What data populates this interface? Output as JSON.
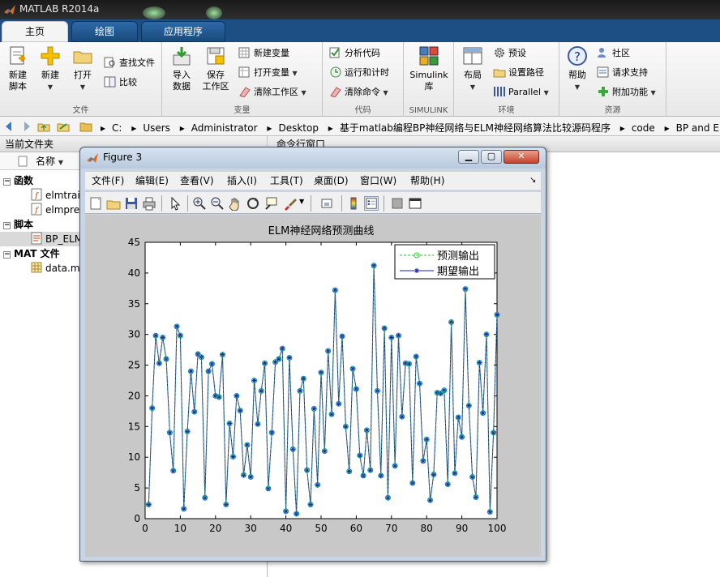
{
  "app": {
    "title": "MATLAB R2014a"
  },
  "tabs": [
    {
      "label": "主页",
      "active": true
    },
    {
      "label": "绘图",
      "active": false
    },
    {
      "label": "应用程序",
      "active": false
    }
  ],
  "ribbon": {
    "file": {
      "label": "文件",
      "new_script": "新建\n脚本",
      "new": "新建",
      "open": "打开",
      "find_files": "查找文件",
      "compare": "比较"
    },
    "variable": {
      "label": "变量",
      "import": "导入\n数据",
      "save_ws": "保存\n工作区",
      "new_var": "新建变量",
      "open_var": "打开变量",
      "clear_ws": "清除工作区"
    },
    "code": {
      "label": "代码",
      "analyze": "分析代码",
      "run_time": "运行和计时",
      "clear_cmd": "清除命令"
    },
    "simulink": {
      "label": "SIMULINK",
      "simulink_lib": "Simulink\n库"
    },
    "environment": {
      "label": "环境",
      "layout": "布局",
      "preferences": "预设",
      "set_path": "设置路径",
      "parallel": "Parallel"
    },
    "resources": {
      "label": "资源",
      "help": "帮助",
      "community": "社区",
      "request_support": "请求支持",
      "addons": "附加功能"
    }
  },
  "address": {
    "crumbs": [
      "C:",
      "Users",
      "Administrator",
      "Desktop",
      "基于matlab编程BP神经网络与ELM神经网络算法比较源码程序",
      "code",
      "BP and ELM"
    ]
  },
  "left_panel": {
    "title": "当前文件夹",
    "column_name": "名称",
    "groups": [
      {
        "label": "函数",
        "items": [
          "elmtrain",
          "elmpredict"
        ]
      },
      {
        "label": "脚本",
        "items": [
          "BP_ELM"
        ]
      },
      {
        "label": "MAT 文件",
        "items": [
          "data.mat"
        ]
      }
    ],
    "visible_items": {
      "elmtrain": "elmtrai",
      "elmpredict": "elmpre",
      "bp_elm": "BP_ELM",
      "data": "data.m"
    }
  },
  "right_panel": {
    "title": "命令行窗口"
  },
  "figure": {
    "title": "Figure 3",
    "menu": [
      "文件(F)",
      "编辑(E)",
      "查看(V)",
      "插入(I)",
      "工具(T)",
      "桌面(D)",
      "窗口(W)",
      "帮助(H)"
    ],
    "toolbar_icons": [
      "new-figure-icon",
      "open-icon",
      "save-icon",
      "print-icon",
      "pointer-icon",
      "zoom-in-icon",
      "zoom-out-icon",
      "pan-icon",
      "rotate-icon",
      "data-cursor-icon",
      "brush-icon",
      "link-icon",
      "colorbar-icon",
      "legend-icon",
      "hide-tools-icon",
      "show-tools-icon"
    ]
  },
  "colors": {
    "expected": "#1c1ca8",
    "predicted": "#2ec82e",
    "marker": "#009999"
  },
  "chart_data": {
    "type": "line",
    "title": "ELM神经网络预测曲线",
    "xlabel": "",
    "ylabel": "",
    "xlim": [
      0,
      100
    ],
    "ylim": [
      0,
      45
    ],
    "xticks": [
      0,
      10,
      20,
      30,
      40,
      50,
      60,
      70,
      80,
      90,
      100
    ],
    "yticks": [
      0,
      5,
      10,
      15,
      20,
      25,
      30,
      35,
      40,
      45
    ],
    "legend_position": "top-right",
    "series": [
      {
        "name": "预测输出",
        "style": "dashed-circle",
        "values": [
          2.3,
          18.0,
          29.8,
          25.3,
          29.5,
          26.0,
          14.0,
          7.8,
          31.3,
          29.8,
          1.6,
          14.2,
          24.0,
          17.4,
          26.8,
          26.3,
          3.4,
          24.0,
          25.2,
          20.0,
          19.8,
          26.7,
          2.3,
          15.5,
          10.1,
          20.0,
          17.6,
          7.1,
          12.0,
          6.8,
          22.5,
          15.4,
          20.8,
          25.3,
          4.9,
          14.0,
          25.5,
          26.0,
          27.7,
          1.2,
          26.2,
          11.3,
          0.8,
          20.8,
          22.8,
          7.9,
          2.3,
          17.9,
          5.5,
          23.8,
          11.0,
          27.3,
          17.0,
          37.2,
          18.7,
          29.7,
          15.0,
          7.7,
          24.4,
          21.1,
          10.3,
          7.0,
          14.4,
          7.9,
          41.2,
          20.8,
          7.0,
          31.0,
          3.4,
          29.5,
          8.6,
          29.8,
          16.6,
          25.3,
          25.2,
          5.8,
          26.4,
          22.0,
          9.4,
          12.9,
          3.0,
          7.2,
          20.5,
          20.4,
          20.9,
          5.6,
          32.0,
          7.4,
          16.5,
          13.3,
          37.4,
          18.4,
          6.8,
          3.5,
          25.4,
          17.2,
          30.0,
          1.1,
          14.0,
          33.2
        ]
      },
      {
        "name": "期望输出",
        "style": "solid-star",
        "values": [
          2.3,
          18.0,
          29.8,
          25.3,
          29.5,
          26.0,
          14.0,
          7.8,
          31.3,
          29.8,
          1.6,
          14.2,
          24.0,
          17.4,
          26.8,
          26.3,
          3.4,
          24.0,
          25.2,
          20.0,
          19.8,
          26.7,
          2.3,
          15.5,
          10.1,
          20.0,
          17.6,
          7.1,
          12.0,
          6.8,
          22.5,
          15.4,
          20.8,
          25.3,
          4.9,
          14.0,
          25.5,
          26.0,
          27.7,
          1.2,
          26.2,
          11.3,
          0.8,
          20.8,
          22.8,
          7.9,
          2.3,
          17.9,
          5.5,
          23.8,
          11.0,
          27.3,
          17.0,
          37.2,
          18.7,
          29.7,
          15.0,
          7.7,
          24.4,
          21.1,
          10.3,
          7.0,
          14.4,
          7.9,
          41.2,
          20.8,
          7.0,
          31.0,
          3.4,
          29.5,
          8.6,
          29.8,
          16.6,
          25.3,
          25.2,
          5.8,
          26.4,
          22.0,
          9.4,
          12.9,
          3.0,
          7.2,
          20.5,
          20.4,
          20.9,
          5.6,
          32.0,
          7.4,
          16.5,
          13.3,
          37.4,
          18.4,
          6.8,
          3.5,
          25.4,
          17.2,
          30.0,
          1.1,
          14.0,
          33.2
        ]
      }
    ]
  }
}
